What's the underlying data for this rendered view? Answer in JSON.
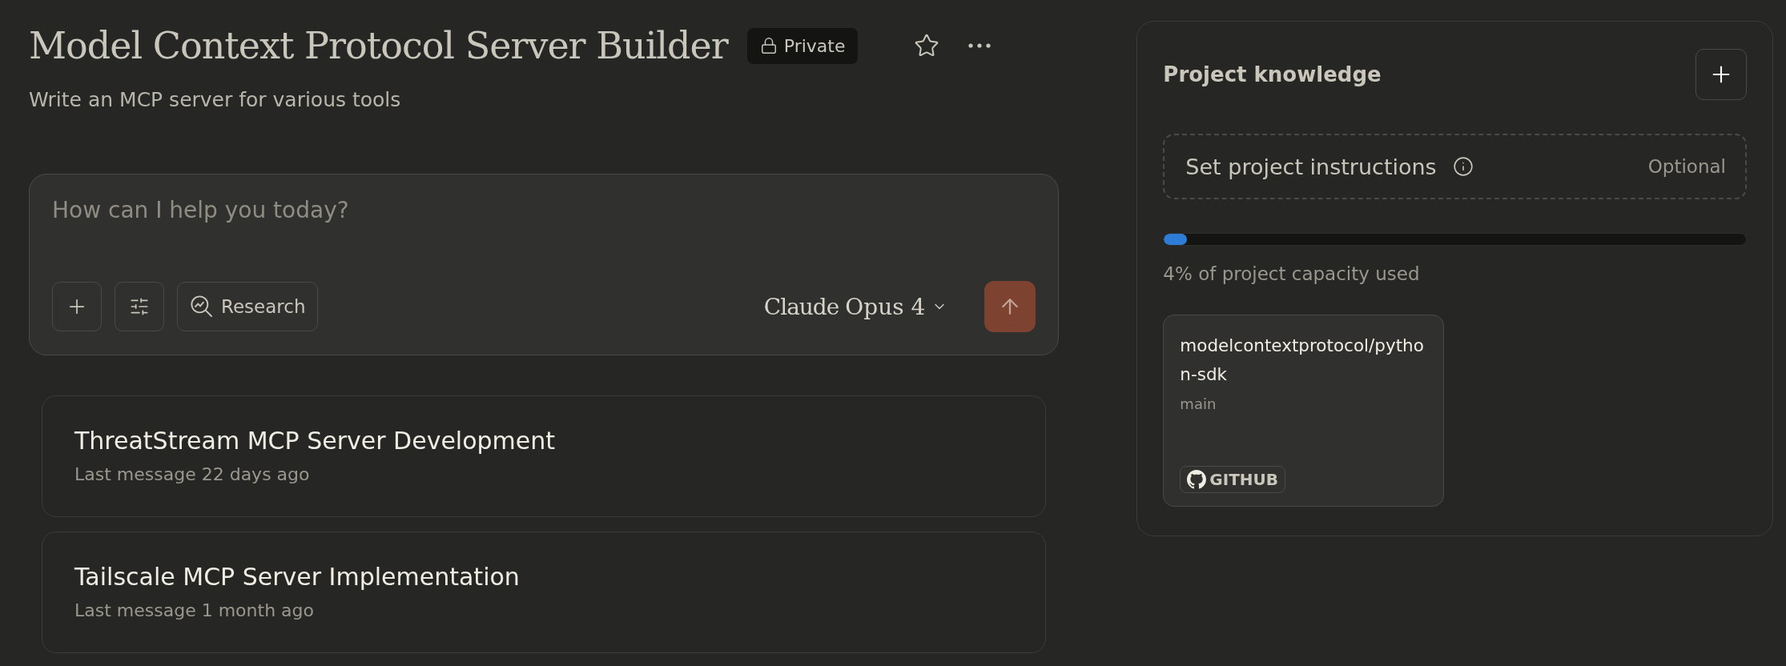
{
  "project": {
    "title": "Model Context Protocol Server Builder",
    "visibility": "Private",
    "description": "Write an MCP server for various tools",
    "starred": false
  },
  "composer": {
    "placeholder": "How can I help you today?",
    "research_label": "Research",
    "model_brand": "Claude",
    "model_name": "Opus 4"
  },
  "chats": [
    {
      "title": "ThreatStream MCP Server Development",
      "meta": "Last message 22 days ago"
    },
    {
      "title": "Tailscale MCP Server Implementation",
      "meta": "Last message 1 month ago"
    }
  ],
  "knowledge": {
    "title": "Project knowledge",
    "instructions_label": "Set project instructions",
    "instructions_tag": "Optional",
    "level": 0.04,
    "capacity_text": "4% of project capacity used",
    "files": [
      {
        "name": "modelcontextprotocol/python-sdk",
        "branch": "main",
        "source": "GITHUB"
      }
    ]
  }
}
